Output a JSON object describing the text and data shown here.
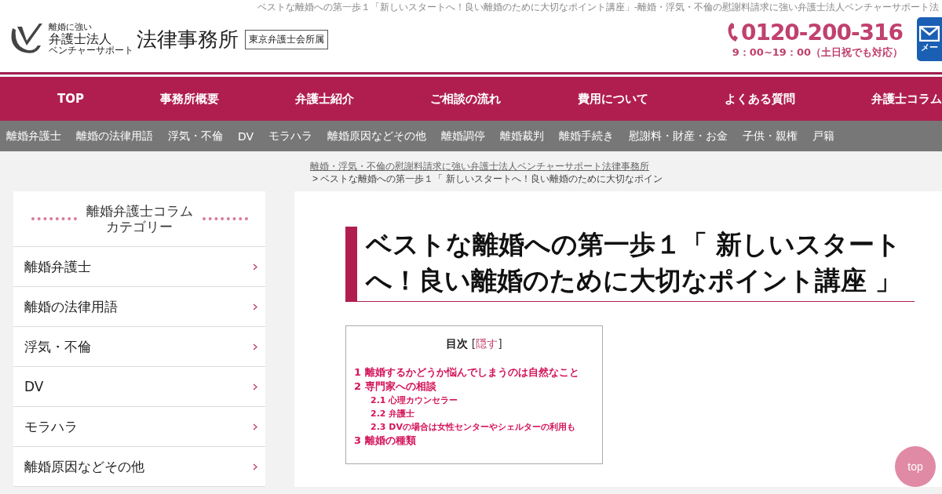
{
  "header": {
    "tagline": "ベストな離婚への第一歩１「新しいスタートへ！良い離婚のために大切なポイント講座」-離婚・浮気・不倫の慰謝料請求に強い弁護士法人ベンチャーサポート法",
    "logo": {
      "small": "離婚に強い",
      "corp": "弁護士法人",
      "sub": "ベンチャーサポート",
      "name": "法律事務所",
      "badge": "東京弁護士会所属"
    },
    "phone": "0120-200-316",
    "hours": "9：00~19：00（土日祝でも対応）",
    "mail_button": "メー"
  },
  "main_nav": [
    "TOP",
    "事務所概要",
    "弁護士紹介",
    "ご相談の流れ",
    "費用について",
    "よくある質問",
    "弁護士コラム"
  ],
  "sub_nav": [
    "離婚弁護士",
    "離婚の法律用語",
    "浮気・不倫",
    "DV",
    "モラハラ",
    "離婚原因などその他",
    "離婚調停",
    "離婚裁判",
    "離婚手続き",
    "慰謝料・財産・お金",
    "子供・親権",
    "戸籍"
  ],
  "breadcrumb": {
    "link": "離婚・浮気・不倫の慰謝料請求に強い弁護士法人ベンチャーサポート法律事務所",
    "current": "> ベストな離婚への第一歩１「 新しいスタートへ！良い離婚のために大切なポイン"
  },
  "sidebar": {
    "title": [
      "離婚弁護士コラム",
      "カテゴリー"
    ],
    "items": [
      "離婚弁護士",
      "離婚の法律用語",
      "浮気・不倫",
      "DV",
      "モラハラ",
      "離婚原因などその他"
    ]
  },
  "article": {
    "title": "ベストな離婚への第一歩１「 新しいスタートへ！良い離婚のために大切なポイント講座 」",
    "toc": {
      "title": "目次",
      "bracket_open": "[",
      "toggle": "隠す",
      "bracket_close": "]",
      "items": [
        {
          "label": "1 離婚するかどうか悩んでしまうのは自然なこと"
        },
        {
          "label": "2 専門家への相談",
          "children": [
            {
              "label": "2.1 心理カウンセラー"
            },
            {
              "label": "2.2 弁護士"
            },
            {
              "label": "2.3 DVの場合は女性センターやシェルターの利用も"
            }
          ]
        },
        {
          "label": "3 離婚の種類"
        }
      ]
    }
  },
  "top_button": "top"
}
